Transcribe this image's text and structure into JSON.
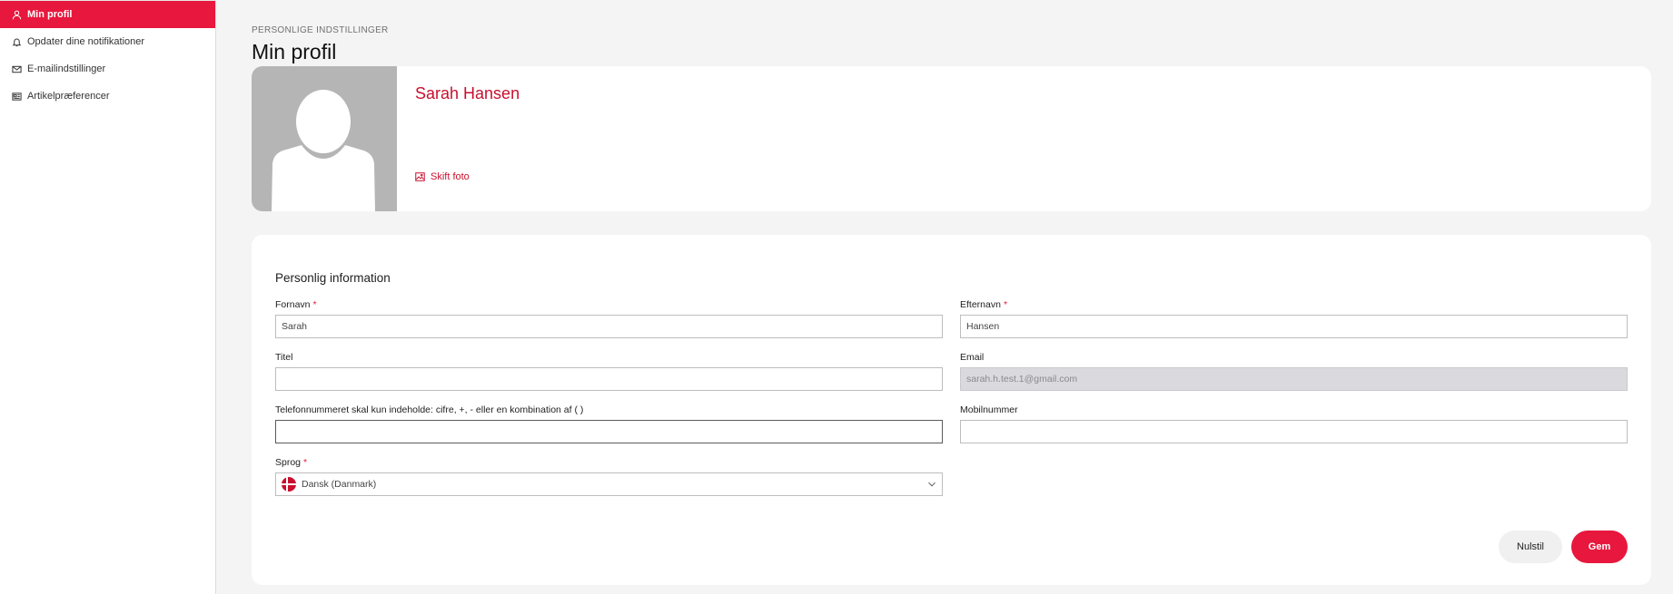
{
  "sidebar": {
    "items": [
      {
        "label": "Min profil",
        "icon": "user-icon",
        "active": true
      },
      {
        "label": "Opdater dine notifikationer",
        "icon": "bell-icon",
        "active": false
      },
      {
        "label": "E-mailindstillinger",
        "icon": "envelope-icon",
        "active": false
      },
      {
        "label": "Artikelpræferencer",
        "icon": "article-icon",
        "active": false
      }
    ]
  },
  "header": {
    "kicker": "PERSONLIGE INDSTILLINGER",
    "title": "Min profil"
  },
  "profile": {
    "name": "Sarah Hansen",
    "change_photo_label": "Skift foto"
  },
  "form": {
    "section_title": "Personlig information",
    "first_name": {
      "label": "Fornavn",
      "required_mark": "*",
      "value": "Sarah"
    },
    "last_name": {
      "label": "Efternavn",
      "required_mark": "*",
      "value": "Hansen"
    },
    "title": {
      "label": "Titel",
      "value": ""
    },
    "email": {
      "label": "Email",
      "value": "sarah.h.test.1@gmail.com"
    },
    "phone": {
      "label": "Telefonnummeret skal kun indeholde: cifre, +, - eller en kombination af ( )",
      "value": ""
    },
    "mobile": {
      "label": "Mobilnummer",
      "value": ""
    },
    "language": {
      "label": "Sprog",
      "required_mark": "*",
      "value": "Dansk (Danmark)"
    },
    "reset_label": "Nulstil",
    "save_label": "Gem"
  },
  "colors": {
    "accent": "#e8173d",
    "name_color": "#c8102e",
    "page_bg": "#f4f4f4",
    "disabled_input_bg": "#dadade"
  }
}
